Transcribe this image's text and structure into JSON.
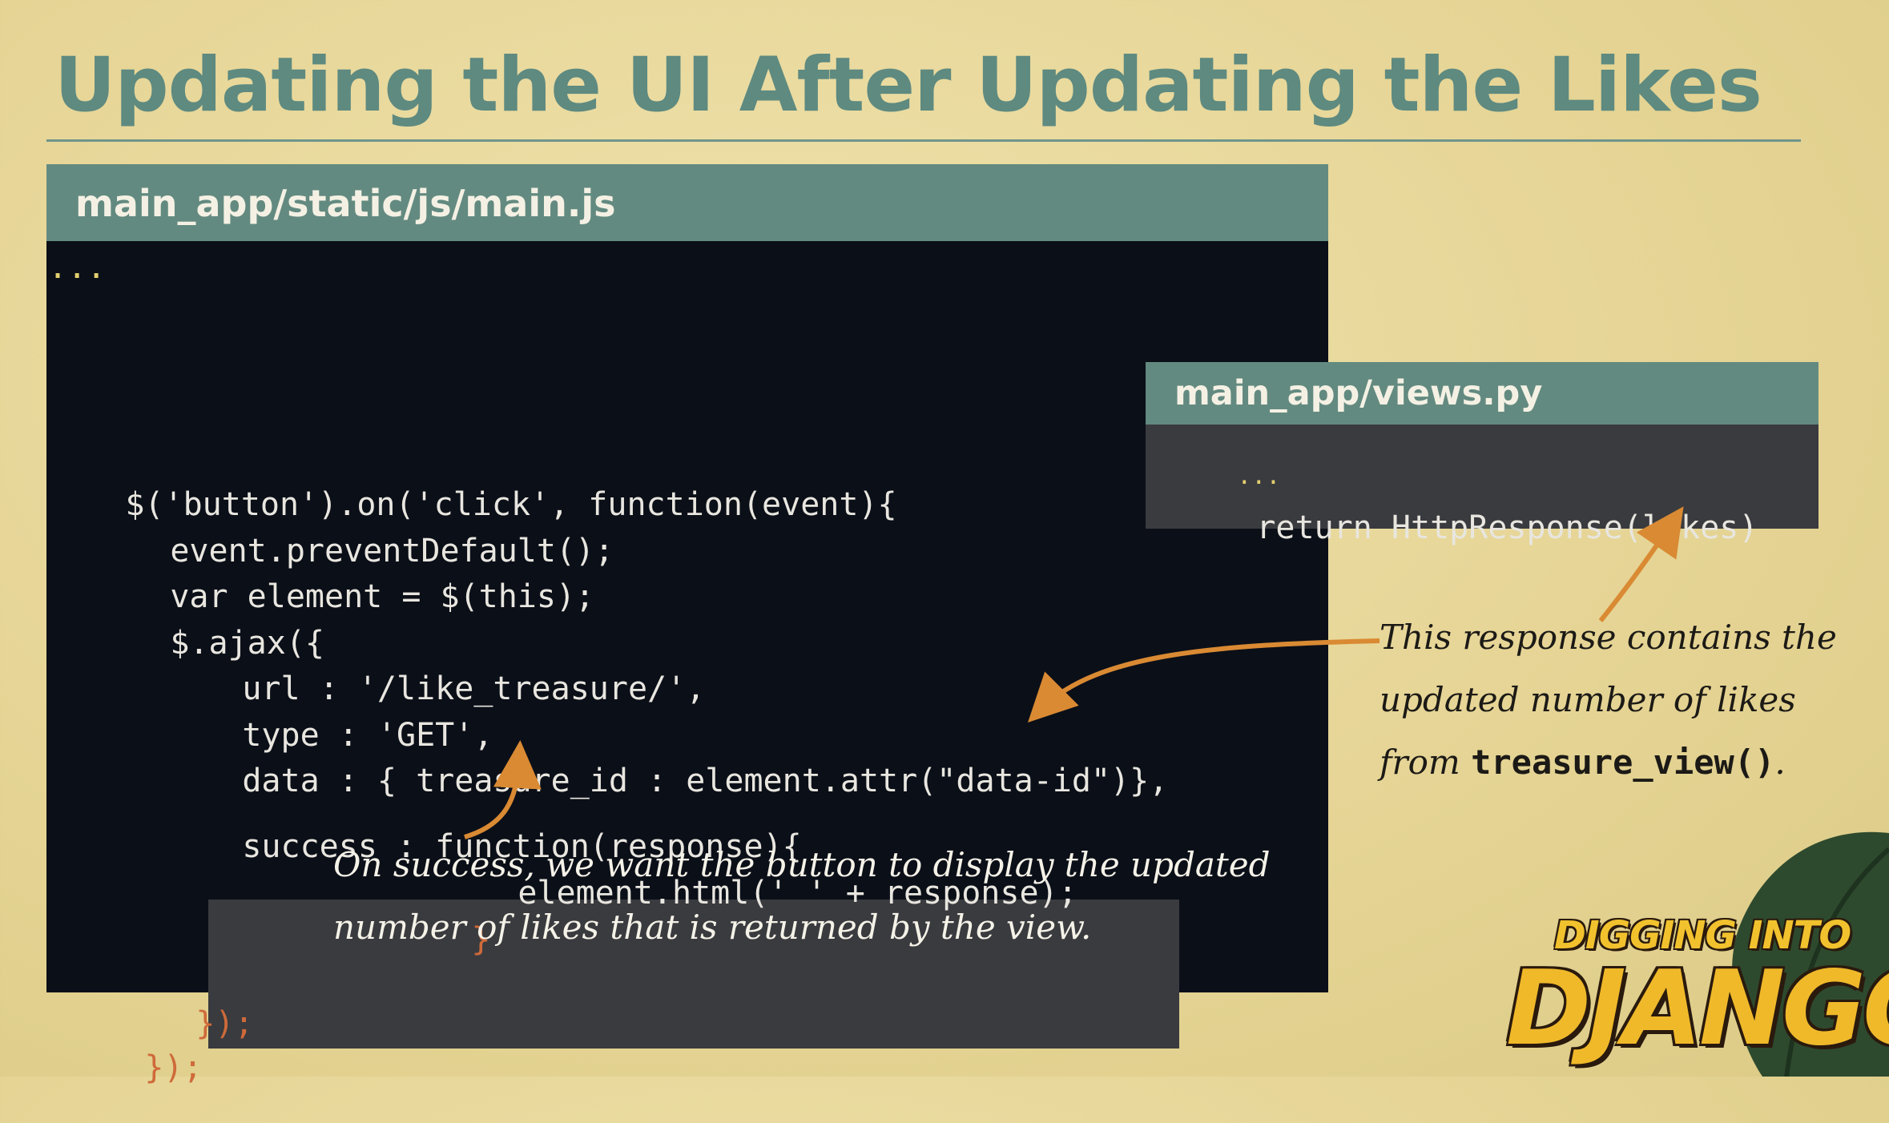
{
  "title": "Updating the UI After Updating the Likes",
  "js_panel": {
    "filename": "main_app/static/js/main.js",
    "lines": [
      "...",
      "$('button').on('click', function(event){",
      "event.preventDefault();",
      "var element = $(this);",
      "$.ajax({",
      "url : '/like_treasure/',",
      "type : 'GET',",
      "data : { treasure_id : element.attr(\"data-id\")},",
      "success : function(response){",
      "element.html(' ' + response);",
      "}",
      "});",
      "});"
    ]
  },
  "py_panel": {
    "filename": "main_app/views.py",
    "lines": [
      "...",
      "return HttpResponse(likes)"
    ]
  },
  "annotations": {
    "right_line1": "This response contains the",
    "right_line2": "updated number of likes",
    "right_line3_prefix": "from",
    "right_line3_code": "treasure_view()",
    "right_line3_suffix": ".",
    "bottom_line1": "On success, we want the button to display the updated",
    "bottom_line2": "number of likes that is returned by the view."
  },
  "logo": {
    "top": "DIGGING INTO",
    "main": "DJANGO"
  },
  "colors": {
    "background": "#e6d596",
    "accent_teal": "#638a80",
    "code_bg": "#0b0f18",
    "highlight_bg": "#3a3b3f",
    "keyword": "#e0872c",
    "function": "#66c26d",
    "string": "#e3cf6e",
    "arrow": "#d98a33"
  }
}
